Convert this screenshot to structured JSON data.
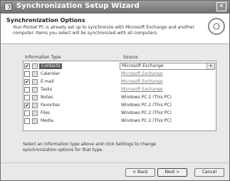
{
  "window": {
    "title": "Synchronization Setup Wizard",
    "close_glyph": "✕"
  },
  "header": {
    "title": "Synchronization Options",
    "description": "Your Pocket PC is already set up to synchronize with Microsoft Exchange and another computer. Items you select will be synchronized with all computers."
  },
  "columns": {
    "type": "Information Type",
    "source": "Source"
  },
  "items": [
    {
      "label": "Contacts",
      "checked": true,
      "selected": true,
      "source": "Microsoft Exchange",
      "source_style": "dropdown"
    },
    {
      "label": "Calendar",
      "checked": false,
      "selected": false,
      "source": "Microsoft Exchange",
      "source_style": "link"
    },
    {
      "label": "E-mail",
      "checked": true,
      "selected": false,
      "source": "Microsoft Exchange",
      "source_style": "link"
    },
    {
      "label": "Tasks",
      "checked": false,
      "selected": false,
      "source": "Microsoft Exchange",
      "source_style": "link"
    },
    {
      "label": "Notes",
      "checked": false,
      "selected": false,
      "source": "Windows PC 2 (This PC)",
      "source_style": "plain"
    },
    {
      "label": "Favorites",
      "checked": true,
      "selected": false,
      "source": "Windows PC 2 (This PC)",
      "source_style": "plain"
    },
    {
      "label": "Files",
      "checked": false,
      "selected": false,
      "source": "Windows PC 2 (This PC)",
      "source_style": "plain"
    },
    {
      "label": "Media",
      "checked": false,
      "selected": false,
      "source": "Windows PC 2 (This PC)",
      "source_style": "plain"
    }
  ],
  "footnote": "Select an information type above and click Settings to change synchronization options for that type.",
  "buttons": {
    "back": "< Back",
    "next": "Next >",
    "cancel": "Cancel"
  },
  "dropdown_arrow": "▾",
  "check_glyph": "✔"
}
